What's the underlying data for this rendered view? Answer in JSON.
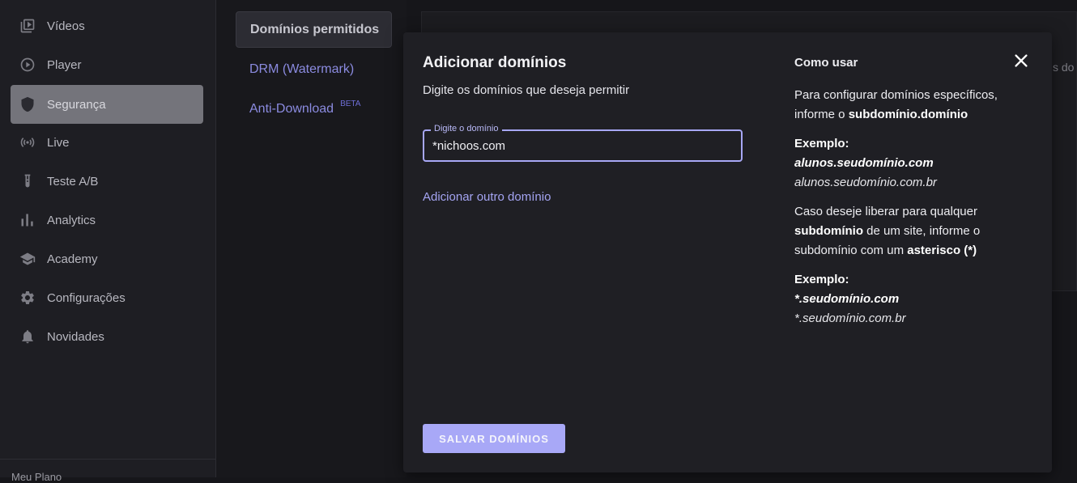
{
  "sidebar": {
    "items": [
      {
        "label": "Vídeos",
        "icon": "video-library-icon"
      },
      {
        "label": "Player",
        "icon": "play-circle-icon"
      },
      {
        "label": "Segurança",
        "icon": "shield-icon",
        "active": true
      },
      {
        "label": "Live",
        "icon": "broadcast-icon"
      },
      {
        "label": "Teste A/B",
        "icon": "test-tube-icon"
      },
      {
        "label": "Analytics",
        "icon": "bar-chart-icon"
      },
      {
        "label": "Academy",
        "icon": "graduation-cap-icon"
      },
      {
        "label": "Configurações",
        "icon": "gear-icon"
      },
      {
        "label": "Novidades",
        "icon": "bell-icon"
      }
    ],
    "footer": "Meu Plano"
  },
  "subnav": {
    "items": [
      {
        "label": "Domínios permitidos",
        "active": true
      },
      {
        "label": "DRM (Watermark)"
      },
      {
        "label": "Anti-Download",
        "badge": "BETA"
      }
    ]
  },
  "background": {
    "peek_text": "s do"
  },
  "modal": {
    "title": "Adicionar domínios",
    "subtitle": "Digite os domínios que deseja permitir",
    "field_label": "Digite o domínio",
    "field_value": "*nichoos.com",
    "add_link": "Adicionar outro domínio",
    "save_label": "SALVAR DOMÍNIOS",
    "help": {
      "title": "Como usar",
      "p1_a": "Para configurar domínios específicos, informe o ",
      "p1_b": "subdomínio.domínio",
      "ex1_head": "Exemplo:",
      "ex1_line1": "alunos.seudomínio.com",
      "ex1_line2": "alunos.seudomínio.com.br",
      "p2_a": "Caso deseje liberar para qualquer ",
      "p2_b": "subdomínio",
      "p2_c": " de um site, informe o subdomínio com um ",
      "p2_d": "asterisco (*)",
      "ex2_head": "Exemplo:",
      "ex2_line1": "*.seudomínio.com",
      "ex2_line2": "*.seudomínio.com.br"
    }
  },
  "colors": {
    "accent": "#a8a8f7",
    "sidebar_active": "#74747b",
    "modal_bg": "#1f1f24"
  }
}
